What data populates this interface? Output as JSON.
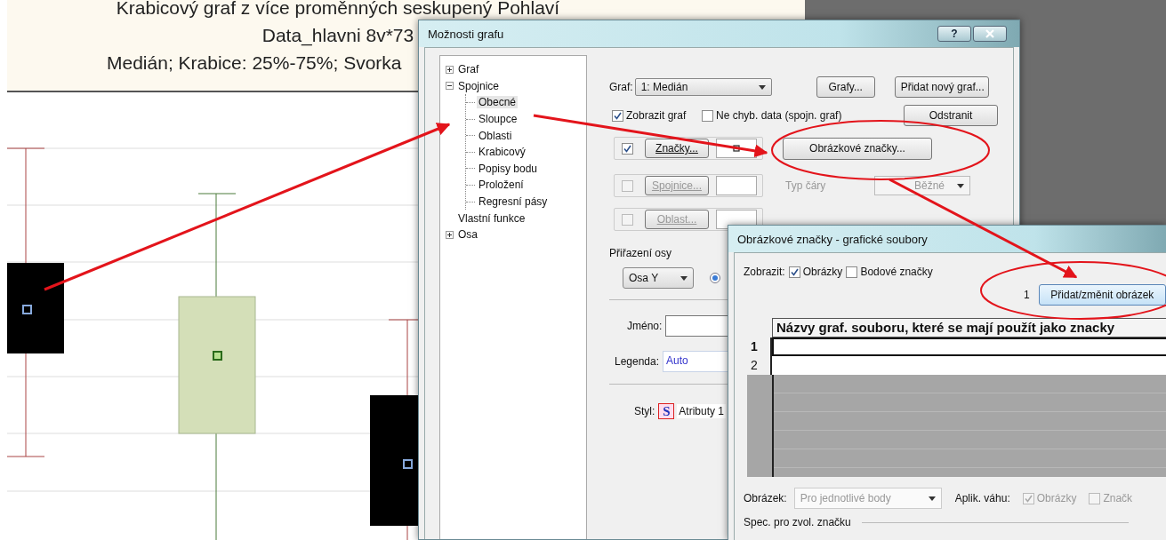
{
  "chart_titles": [
    "Krabicový graf z více proměnných seskupený Pohlaví",
    "Data_hlavni 8v*73",
    "Medián; Krabice: 25%-75%; Svorka"
  ],
  "options_dialog": {
    "title": "Možnosti grafu",
    "help_button": "?",
    "tree": [
      {
        "label": "Graf",
        "expanded": false,
        "selected": false
      },
      {
        "label": "Spojnice",
        "expanded": true,
        "selected": false,
        "children": [
          {
            "label": "Obecné",
            "selected": true
          },
          {
            "label": "Sloupce",
            "selected": false
          },
          {
            "label": "Oblasti",
            "selected": false
          },
          {
            "label": "Krabicový",
            "selected": false
          },
          {
            "label": "Popisy bodu",
            "selected": false
          },
          {
            "label": "Proložení",
            "selected": false
          },
          {
            "label": "Regresní pásy",
            "selected": false
          }
        ]
      },
      {
        "label": "Vlastní funkce",
        "selected": false
      },
      {
        "label": "Osa",
        "expanded": false,
        "selected": false
      }
    ],
    "graph_field": {
      "label": "Graf:",
      "value": "1: Medián"
    },
    "graphs_button": "Grafy...",
    "add_graph_button": "Přidat nový graf...",
    "remove_button": "Odstranit",
    "show_options": [
      {
        "label": "Zobrazit graf",
        "checked": true
      },
      {
        "label": "Ne chyb. data (spojn. graf)",
        "checked": false
      }
    ],
    "elements": [
      {
        "label": "Značky...",
        "checked": true,
        "disabled": false
      },
      {
        "label": "Spojnice...",
        "checked": false,
        "disabled": true
      },
      {
        "label": "Oblast...",
        "checked": false,
        "disabled": true
      }
    ],
    "image_markers_button": "Obrázkové značky...",
    "line_type": {
      "label": "Typ čáry",
      "value": "Běžné",
      "disabled": true
    },
    "axis": {
      "label": "Přiřazení osy",
      "value": "Osa Y",
      "option_selected": true
    },
    "name_field": {
      "label": "Jméno:"
    },
    "legend_field": {
      "label": "Legenda:",
      "value": "Auto"
    },
    "style": {
      "label": "Styl:",
      "icon": "S",
      "value": "Atributy 1"
    }
  },
  "image_dialog": {
    "title": "Obrázkové značky - grafické soubory",
    "show_label": "Zobrazit:",
    "show_options": [
      {
        "label": "Obrázky",
        "checked": true
      },
      {
        "label": "Bodové značky",
        "checked": false
      }
    ],
    "count": "1",
    "add_button": "Přidat/změnit obrázek",
    "table": {
      "column": "Názvy graf. souboru, které se mají použít jako znacky",
      "rows": [
        {
          "number": "1",
          "selected": true
        },
        {
          "number": "2",
          "selected": false
        }
      ]
    },
    "image_field": {
      "label": "Obrázek:",
      "value": "Pro jednotlivé body",
      "disabled": true
    },
    "weight_label": "Aplik. váhu:",
    "weight_options": [
      {
        "label": "Obrázky",
        "checked": true,
        "disabled": true
      },
      {
        "label": "Značk",
        "checked": false,
        "disabled": true
      }
    ],
    "section": "Spec. pro zvol. značku"
  }
}
